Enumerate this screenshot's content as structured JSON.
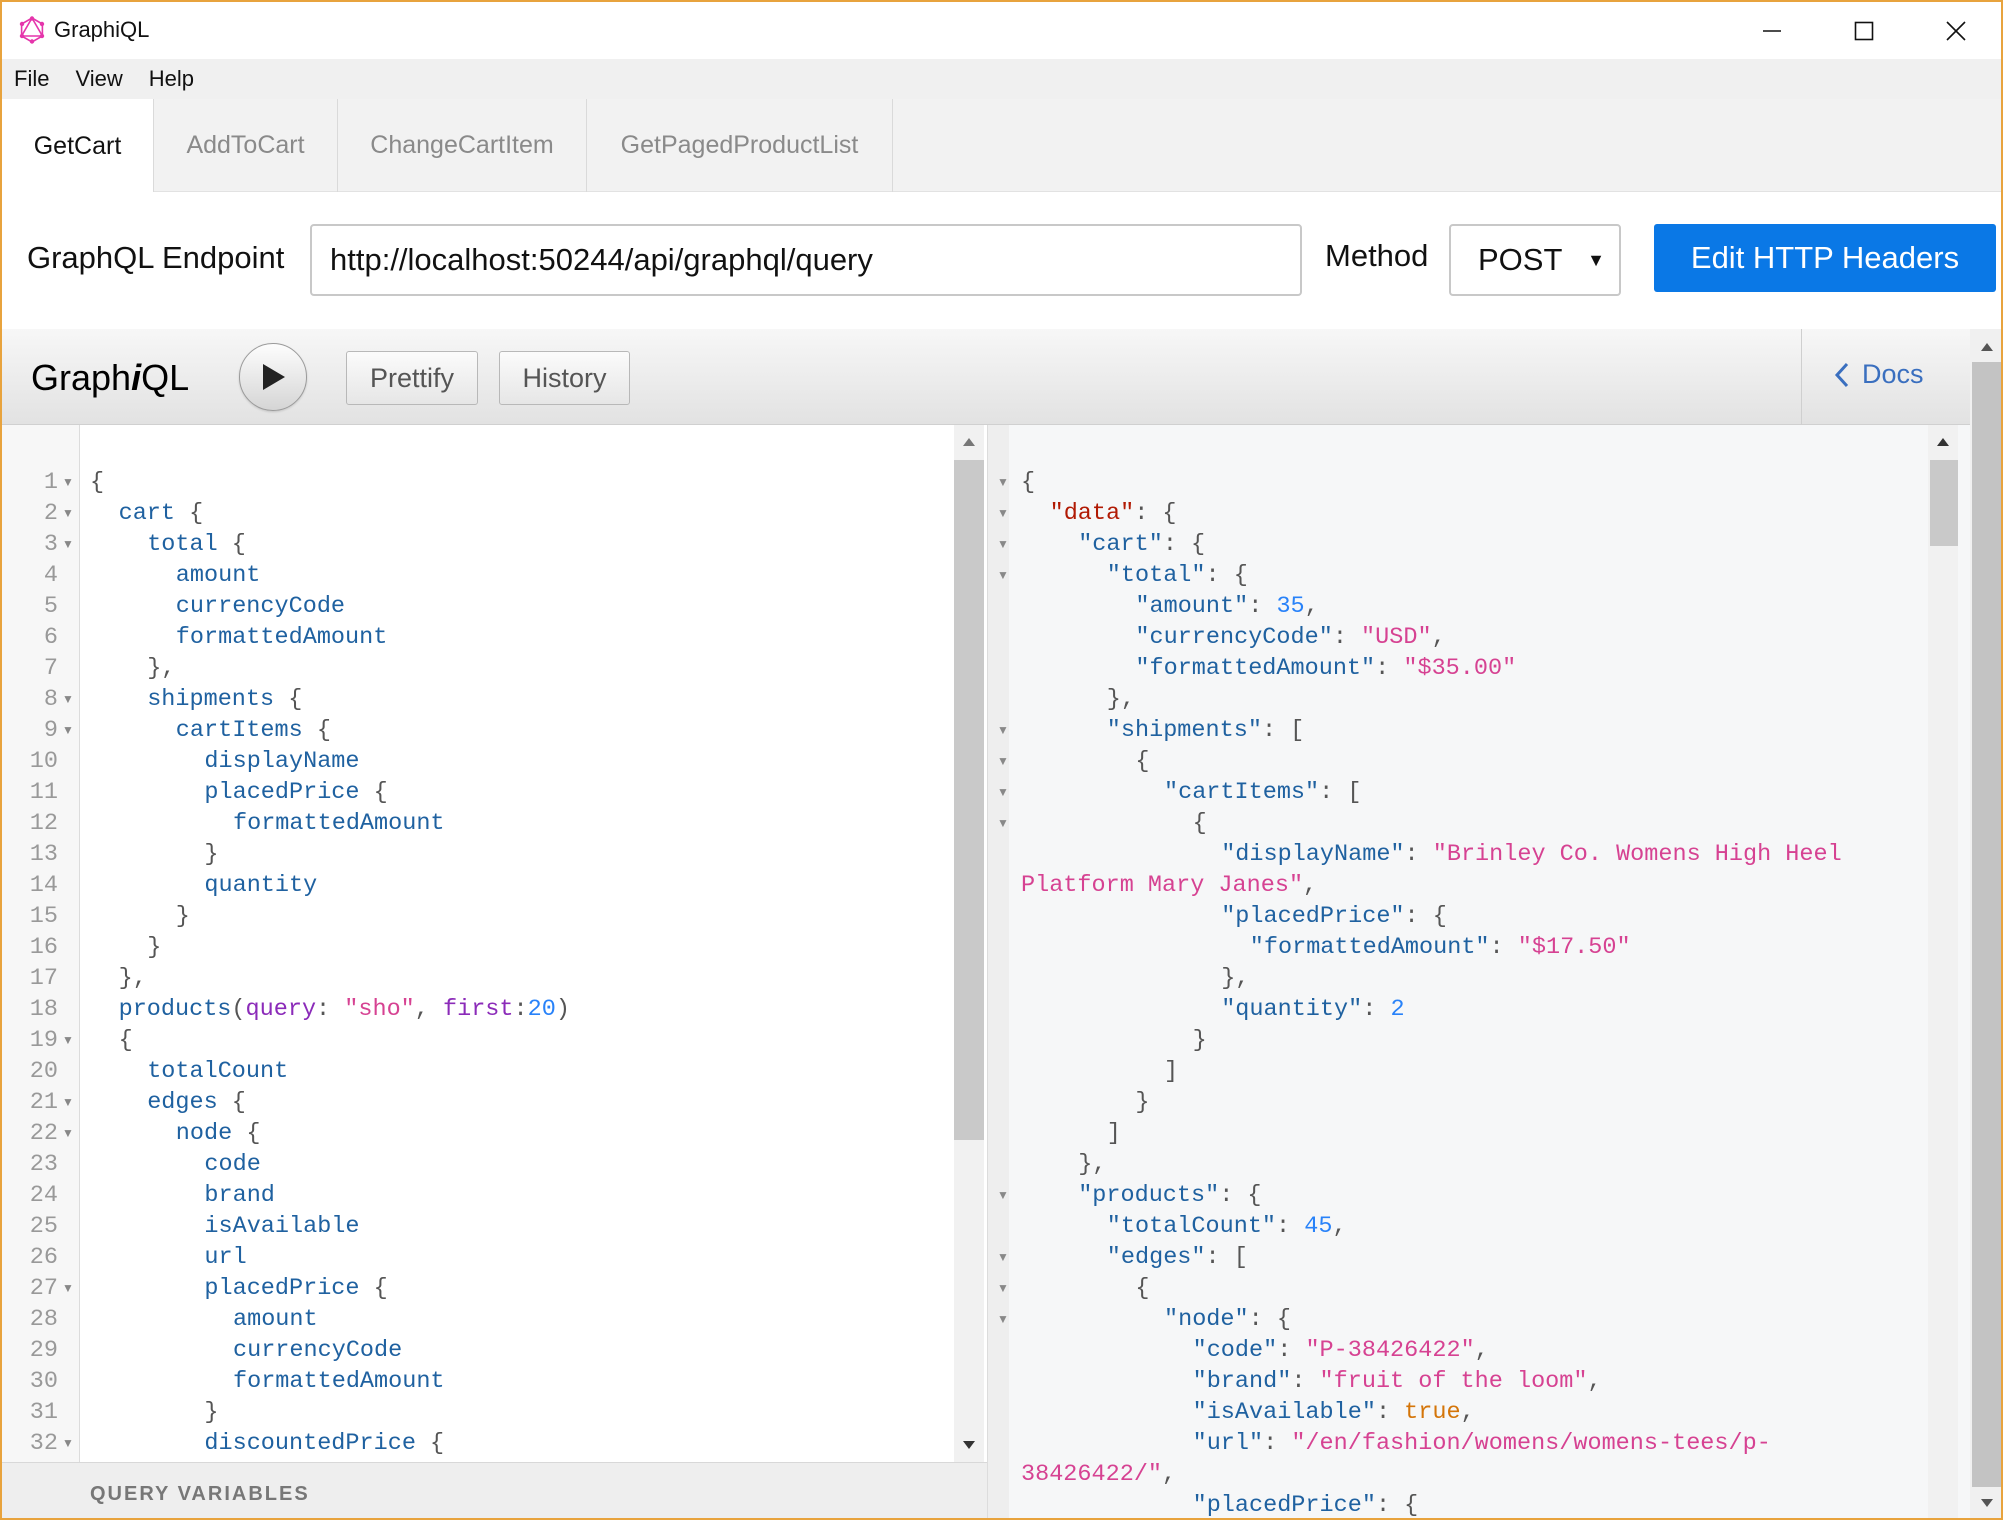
{
  "window": {
    "title": "GraphiQL",
    "accent_color": "#e8a33d"
  },
  "menu": [
    "File",
    "View",
    "Help"
  ],
  "tabs": [
    {
      "label": "GetCart",
      "active": true
    },
    {
      "label": "AddToCart",
      "active": false
    },
    {
      "label": "ChangeCartItem",
      "active": false
    },
    {
      "label": "GetPagedProductList",
      "active": false
    }
  ],
  "endpoint": {
    "label": "GraphQL Endpoint",
    "value": "http://localhost:50244/api/graphql/query",
    "method_label": "Method",
    "method_value": "POST",
    "edit_headers_label": "Edit HTTP Headers",
    "button_color": "#0a78e6"
  },
  "toolbar": {
    "logo_prefix": "Graph",
    "logo_italic": "i",
    "logo_suffix": "QL",
    "prettify_label": "Prettify",
    "history_label": "History",
    "docs_label": "Docs"
  },
  "query_variables_label": "QUERY VARIABLES",
  "query_lines": [
    {
      "n": "1",
      "fold": true,
      "indent": 0,
      "tokens": [
        [
          "p",
          "{"
        ]
      ]
    },
    {
      "n": "2",
      "fold": true,
      "indent": 1,
      "tokens": [
        [
          "f",
          "cart"
        ],
        [
          "p",
          " {"
        ]
      ]
    },
    {
      "n": "3",
      "fold": true,
      "indent": 2,
      "tokens": [
        [
          "f",
          "total"
        ],
        [
          "p",
          " {"
        ]
      ]
    },
    {
      "n": "4",
      "fold": false,
      "indent": 3,
      "tokens": [
        [
          "f",
          "amount"
        ]
      ]
    },
    {
      "n": "5",
      "fold": false,
      "indent": 3,
      "tokens": [
        [
          "f",
          "currencyCode"
        ]
      ]
    },
    {
      "n": "6",
      "fold": false,
      "indent": 3,
      "tokens": [
        [
          "f",
          "formattedAmount"
        ]
      ]
    },
    {
      "n": "7",
      "fold": false,
      "indent": 2,
      "tokens": [
        [
          "p",
          "},"
        ]
      ]
    },
    {
      "n": "8",
      "fold": true,
      "indent": 2,
      "tokens": [
        [
          "f",
          "shipments"
        ],
        [
          "p",
          " {"
        ]
      ]
    },
    {
      "n": "9",
      "fold": true,
      "indent": 3,
      "tokens": [
        [
          "f",
          "cartItems"
        ],
        [
          "p",
          " {"
        ]
      ]
    },
    {
      "n": "10",
      "fold": false,
      "indent": 4,
      "tokens": [
        [
          "f",
          "displayName"
        ]
      ]
    },
    {
      "n": "11",
      "fold": false,
      "indent": 4,
      "tokens": [
        [
          "f",
          "placedPrice"
        ],
        [
          "p",
          " {"
        ]
      ]
    },
    {
      "n": "12",
      "fold": false,
      "indent": 5,
      "tokens": [
        [
          "f",
          "formattedAmount"
        ]
      ]
    },
    {
      "n": "13",
      "fold": false,
      "indent": 4,
      "tokens": [
        [
          "p",
          "}"
        ]
      ]
    },
    {
      "n": "14",
      "fold": false,
      "indent": 4,
      "tokens": [
        [
          "f",
          "quantity"
        ]
      ]
    },
    {
      "n": "15",
      "fold": false,
      "indent": 3,
      "tokens": [
        [
          "p",
          "}"
        ]
      ]
    },
    {
      "n": "16",
      "fold": false,
      "indent": 2,
      "tokens": [
        [
          "p",
          "}"
        ]
      ]
    },
    {
      "n": "17",
      "fold": false,
      "indent": 1,
      "tokens": [
        [
          "p",
          "},"
        ]
      ]
    },
    {
      "n": "18",
      "fold": false,
      "indent": 1,
      "tokens": [
        [
          "f",
          "products"
        ],
        [
          "p",
          "("
        ],
        [
          "a",
          "query"
        ],
        [
          "p",
          ": "
        ],
        [
          "s",
          "\"sho\""
        ],
        [
          "p",
          ", "
        ],
        [
          "a",
          "first"
        ],
        [
          "p",
          ":"
        ],
        [
          "n",
          "20"
        ],
        [
          "p",
          ")"
        ]
      ]
    },
    {
      "n": "19",
      "fold": true,
      "indent": 1,
      "tokens": [
        [
          "p",
          "{"
        ]
      ]
    },
    {
      "n": "20",
      "fold": false,
      "indent": 2,
      "tokens": [
        [
          "f",
          "totalCount"
        ]
      ]
    },
    {
      "n": "21",
      "fold": true,
      "indent": 2,
      "tokens": [
        [
          "f",
          "edges"
        ],
        [
          "p",
          " {"
        ]
      ]
    },
    {
      "n": "22",
      "fold": true,
      "indent": 3,
      "tokens": [
        [
          "f",
          "node"
        ],
        [
          "p",
          " {"
        ]
      ]
    },
    {
      "n": "23",
      "fold": false,
      "indent": 4,
      "tokens": [
        [
          "f",
          "code"
        ]
      ]
    },
    {
      "n": "24",
      "fold": false,
      "indent": 4,
      "tokens": [
        [
          "f",
          "brand"
        ]
      ]
    },
    {
      "n": "25",
      "fold": false,
      "indent": 4,
      "tokens": [
        [
          "f",
          "isAvailable"
        ]
      ]
    },
    {
      "n": "26",
      "fold": false,
      "indent": 4,
      "tokens": [
        [
          "f",
          "url"
        ]
      ]
    },
    {
      "n": "27",
      "fold": true,
      "indent": 4,
      "tokens": [
        [
          "f",
          "placedPrice"
        ],
        [
          "p",
          " {"
        ]
      ]
    },
    {
      "n": "28",
      "fold": false,
      "indent": 5,
      "tokens": [
        [
          "f",
          "amount"
        ]
      ]
    },
    {
      "n": "29",
      "fold": false,
      "indent": 5,
      "tokens": [
        [
          "f",
          "currencyCode"
        ]
      ]
    },
    {
      "n": "30",
      "fold": false,
      "indent": 5,
      "tokens": [
        [
          "f",
          "formattedAmount"
        ]
      ]
    },
    {
      "n": "31",
      "fold": false,
      "indent": 4,
      "tokens": [
        [
          "p",
          "}"
        ]
      ]
    },
    {
      "n": "32",
      "fold": true,
      "indent": 4,
      "tokens": [
        [
          "f",
          "discountedPrice"
        ],
        [
          "p",
          " {"
        ]
      ]
    }
  ],
  "result_lines": [
    {
      "fold": true,
      "indent": 0,
      "tokens": [
        [
          "p",
          "{"
        ]
      ]
    },
    {
      "fold": true,
      "indent": 1,
      "tokens": [
        [
          "k",
          "\"data\""
        ],
        [
          "p",
          ": {"
        ]
      ]
    },
    {
      "fold": true,
      "indent": 2,
      "tokens": [
        [
          "f",
          "\"cart\""
        ],
        [
          "p",
          ": {"
        ]
      ]
    },
    {
      "fold": true,
      "indent": 3,
      "tokens": [
        [
          "f",
          "\"total\""
        ],
        [
          "p",
          ": {"
        ]
      ]
    },
    {
      "fold": false,
      "indent": 4,
      "tokens": [
        [
          "f",
          "\"amount\""
        ],
        [
          "p",
          ": "
        ],
        [
          "n",
          "35"
        ],
        [
          "p",
          ","
        ]
      ]
    },
    {
      "fold": false,
      "indent": 4,
      "tokens": [
        [
          "f",
          "\"currencyCode\""
        ],
        [
          "p",
          ": "
        ],
        [
          "s",
          "\"USD\""
        ],
        [
          "p",
          ","
        ]
      ]
    },
    {
      "fold": false,
      "indent": 4,
      "tokens": [
        [
          "f",
          "\"formattedAmount\""
        ],
        [
          "p",
          ": "
        ],
        [
          "s",
          "\"$35.00\""
        ]
      ]
    },
    {
      "fold": false,
      "indent": 3,
      "tokens": [
        [
          "p",
          "},"
        ]
      ]
    },
    {
      "fold": true,
      "indent": 3,
      "tokens": [
        [
          "f",
          "\"shipments\""
        ],
        [
          "p",
          ": ["
        ]
      ]
    },
    {
      "fold": true,
      "indent": 4,
      "tokens": [
        [
          "p",
          "{"
        ]
      ]
    },
    {
      "fold": true,
      "indent": 5,
      "tokens": [
        [
          "f",
          "\"cartItems\""
        ],
        [
          "p",
          ": ["
        ]
      ]
    },
    {
      "fold": true,
      "indent": 6,
      "tokens": [
        [
          "p",
          "{"
        ]
      ]
    },
    {
      "fold": false,
      "indent": 7,
      "tokens": [
        [
          "f",
          "\"displayName\""
        ],
        [
          "p",
          ": "
        ],
        [
          "s",
          "\"Brinley Co. Womens High Heel"
        ]
      ]
    },
    {
      "fold": false,
      "indent": 0,
      "tokens": [
        [
          "s",
          "Platform Mary Janes\""
        ],
        [
          "p",
          ","
        ]
      ]
    },
    {
      "fold": false,
      "indent": 7,
      "tokens": [
        [
          "f",
          "\"placedPrice\""
        ],
        [
          "p",
          ": {"
        ]
      ]
    },
    {
      "fold": false,
      "indent": 8,
      "tokens": [
        [
          "f",
          "\"formattedAmount\""
        ],
        [
          "p",
          ": "
        ],
        [
          "s",
          "\"$17.50\""
        ]
      ]
    },
    {
      "fold": false,
      "indent": 7,
      "tokens": [
        [
          "p",
          "},"
        ]
      ]
    },
    {
      "fold": false,
      "indent": 7,
      "tokens": [
        [
          "f",
          "\"quantity\""
        ],
        [
          "p",
          ": "
        ],
        [
          "n",
          "2"
        ]
      ]
    },
    {
      "fold": false,
      "indent": 6,
      "tokens": [
        [
          "p",
          "}"
        ]
      ]
    },
    {
      "fold": false,
      "indent": 5,
      "tokens": [
        [
          "p",
          "]"
        ]
      ]
    },
    {
      "fold": false,
      "indent": 4,
      "tokens": [
        [
          "p",
          "}"
        ]
      ]
    },
    {
      "fold": false,
      "indent": 3,
      "tokens": [
        [
          "p",
          "]"
        ]
      ]
    },
    {
      "fold": false,
      "indent": 2,
      "tokens": [
        [
          "p",
          "},"
        ]
      ]
    },
    {
      "fold": true,
      "indent": 2,
      "tokens": [
        [
          "f",
          "\"products\""
        ],
        [
          "p",
          ": {"
        ]
      ]
    },
    {
      "fold": false,
      "indent": 3,
      "tokens": [
        [
          "f",
          "\"totalCount\""
        ],
        [
          "p",
          ": "
        ],
        [
          "n",
          "45"
        ],
        [
          "p",
          ","
        ]
      ]
    },
    {
      "fold": true,
      "indent": 3,
      "tokens": [
        [
          "f",
          "\"edges\""
        ],
        [
          "p",
          ": ["
        ]
      ]
    },
    {
      "fold": true,
      "indent": 4,
      "tokens": [
        [
          "p",
          "{"
        ]
      ]
    },
    {
      "fold": true,
      "indent": 5,
      "tokens": [
        [
          "f",
          "\"node\""
        ],
        [
          "p",
          ": {"
        ]
      ]
    },
    {
      "fold": false,
      "indent": 6,
      "tokens": [
        [
          "f",
          "\"code\""
        ],
        [
          "p",
          ": "
        ],
        [
          "s",
          "\"P-38426422\""
        ],
        [
          "p",
          ","
        ]
      ]
    },
    {
      "fold": false,
      "indent": 6,
      "tokens": [
        [
          "f",
          "\"brand\""
        ],
        [
          "p",
          ": "
        ],
        [
          "s",
          "\"fruit of the loom\""
        ],
        [
          "p",
          ","
        ]
      ]
    },
    {
      "fold": false,
      "indent": 6,
      "tokens": [
        [
          "f",
          "\"isAvailable\""
        ],
        [
          "p",
          ": "
        ],
        [
          "b",
          "true"
        ],
        [
          "p",
          ","
        ]
      ]
    },
    {
      "fold": false,
      "indent": 6,
      "tokens": [
        [
          "f",
          "\"url\""
        ],
        [
          "p",
          ": "
        ],
        [
          "s",
          "\"/en/fashion/womens/womens-tees/p-"
        ]
      ]
    },
    {
      "fold": false,
      "indent": 0,
      "tokens": [
        [
          "s",
          "38426422/\""
        ],
        [
          "p",
          ","
        ]
      ]
    },
    {
      "fold": false,
      "indent": 6,
      "tokens": [
        [
          "f",
          "\"placedPrice\""
        ],
        [
          "p",
          ": {"
        ]
      ]
    }
  ]
}
